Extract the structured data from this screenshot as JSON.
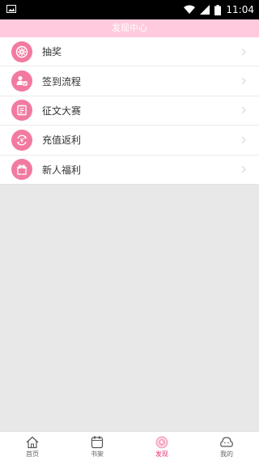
{
  "status_bar": {
    "time": "11:04"
  },
  "header": {
    "title": "发现中心"
  },
  "menu": {
    "items": [
      {
        "label": "抽奖",
        "icon": "lottery-wheel-icon"
      },
      {
        "label": "签到流程",
        "icon": "checkin-icon"
      },
      {
        "label": "征文大赛",
        "icon": "essay-contest-icon"
      },
      {
        "label": "充值返利",
        "icon": "recharge-rebate-icon"
      },
      {
        "label": "新人福利",
        "icon": "gift-icon"
      }
    ]
  },
  "tabbar": {
    "items": [
      {
        "label": "首页",
        "icon": "home-icon"
      },
      {
        "label": "书架",
        "icon": "bookshelf-icon"
      },
      {
        "label": "发现",
        "icon": "discover-icon",
        "active": true
      },
      {
        "label": "我的",
        "icon": "profile-icon"
      }
    ]
  },
  "colors": {
    "accent": "#f27aa0",
    "header_bg": "#ffcadd",
    "active_tab": "#e8337a"
  }
}
